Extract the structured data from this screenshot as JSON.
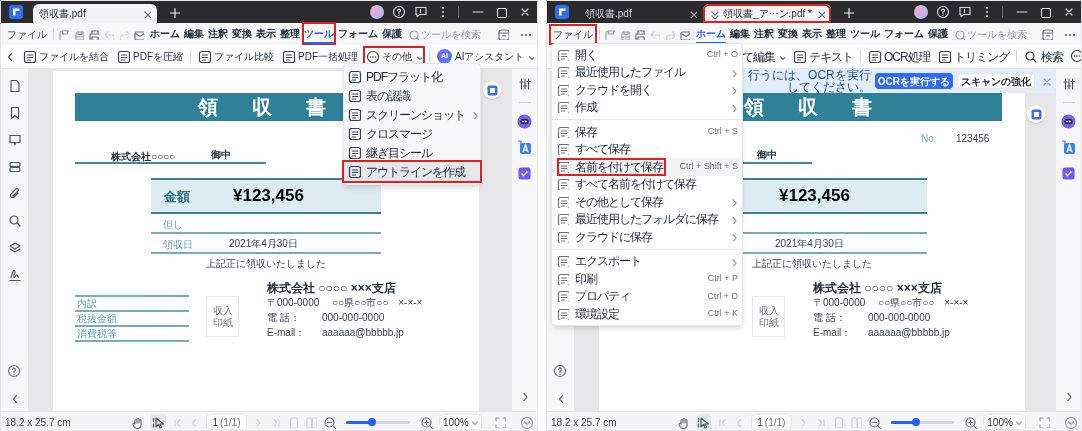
{
  "panes": [
    {
      "title_tabs": [
        {
          "label": "領収書.pdf",
          "selected": true,
          "highlighted": false,
          "kind": "plain"
        }
      ],
      "menubar": {
        "file": {
          "label": "ファイル",
          "highlighted": false
        },
        "search_placeholder": "ツールを検索",
        "tabs": [
          {
            "label": "ホーム",
            "selected": false,
            "highlighted": false
          },
          {
            "label": "編集",
            "selected": false,
            "highlighted": false
          },
          {
            "label": "注釈",
            "selected": false,
            "highlighted": false
          },
          {
            "label": "変換",
            "selected": false,
            "highlighted": false
          },
          {
            "label": "表示",
            "selected": false,
            "highlighted": false
          },
          {
            "label": "整理",
            "selected": false,
            "highlighted": false
          },
          {
            "label": "ツール",
            "selected": true,
            "highlighted": true
          },
          {
            "label": "フォーム",
            "selected": false,
            "highlighted": false
          },
          {
            "label": "保護",
            "selected": false,
            "highlighted": false
          }
        ]
      },
      "toolbar": [
        {
          "kind": "scroll"
        },
        {
          "kind": "button",
          "label": "ファイルを結合",
          "highlighted": false
        },
        {
          "kind": "button",
          "label": "PDFを圧縮",
          "highlighted": false
        },
        {
          "kind": "separator"
        },
        {
          "kind": "button",
          "label": "ファイル比較",
          "highlighted": false
        },
        {
          "kind": "button",
          "label": "PDF一括処理",
          "highlighted": false
        },
        {
          "kind": "dropdown",
          "label": "その他",
          "highlighted": true
        },
        {
          "kind": "separator"
        },
        {
          "kind": "ai",
          "badge": "AI",
          "label": "AIアシスタント",
          "highlighted": false
        }
      ],
      "tools_menu": {
        "items": [
          {
            "label": "PDFフラット化",
            "submenu": false,
            "highlighted": false
          },
          {
            "label": "表の認識",
            "submenu": false,
            "highlighted": false
          },
          {
            "label": "スクリーンショット",
            "submenu": true,
            "highlighted": false
          },
          {
            "label": "クロスマージ",
            "submenu": false,
            "highlighted": false
          },
          {
            "label": "継ぎ目シール",
            "submenu": false,
            "highlighted": false
          },
          {
            "label": "アウトラインを作成",
            "submenu": false,
            "highlighted": true
          }
        ]
      },
      "document": {
        "title": "領　収　書",
        "addressee": "株式会社○○○○",
        "honorific": "御中",
        "amount_label": "金額",
        "amount": "¥123,456",
        "proviso_label": "但し",
        "date_label": "領収日",
        "date": "2021年4月30日",
        "statement": "上記正に領収いたしました",
        "breakdown": [
          "内訳",
          "税抜金額",
          "消費税等"
        ],
        "stamp": "収入印紙",
        "company": "株式会社 ○○○○ ×××支店",
        "address": "〒000-0000　 ○○県○○市○○　×-×-×",
        "contacts": [
          {
            "label": "電 話：",
            "value": "000-000-0000"
          },
          {
            "label": "E-mail：",
            "value": "aaaaaa@bbbbb.jp"
          }
        ]
      },
      "status": {
        "size": "18.2 x 25.7 cm",
        "page": "1",
        "page_total": "(1/1)",
        "zoom_slider": {
          "level": 0.4
        },
        "zoom": "100%"
      }
    },
    {
      "title_tabs": [
        {
          "label": "領収書.pdf",
          "selected": false,
          "highlighted": false,
          "kind": "plain"
        },
        {
          "label": "領収書_ア···ン.pdf *",
          "selected": true,
          "highlighted": true,
          "kind": "collapsed"
        }
      ],
      "menubar": {
        "file": {
          "label": "ファイル",
          "highlighted": true
        },
        "search_placeholder": "ツールを検索",
        "tabs": [
          {
            "label": "ホーム",
            "selected": true,
            "highlighted": false
          },
          {
            "label": "編集",
            "selected": false,
            "highlighted": false
          },
          {
            "label": "注釈",
            "selected": false,
            "highlighted": false
          },
          {
            "label": "変換",
            "selected": false,
            "highlighted": false
          },
          {
            "label": "表示",
            "selected": false,
            "highlighted": false
          },
          {
            "label": "整理",
            "selected": false,
            "highlighted": false
          },
          {
            "label": "ツール",
            "selected": false,
            "highlighted": false
          },
          {
            "label": "フォーム",
            "selected": false,
            "highlighted": false
          },
          {
            "label": "保護",
            "selected": false,
            "highlighted": false
          }
        ]
      },
      "toolbar": [
        {
          "kind": "text_dropdown",
          "label": "て編集",
          "highlighted": false
        },
        {
          "kind": "button",
          "label": "テキスト",
          "highlighted": false
        },
        {
          "kind": "separator"
        },
        {
          "kind": "button",
          "label": "OCR処理",
          "highlighted": false
        },
        {
          "kind": "button",
          "label": "トリミング",
          "highlighted": false
        },
        {
          "kind": "separator"
        },
        {
          "kind": "search",
          "label": "検索",
          "highlighted": false
        },
        {
          "kind": "partial"
        }
      ],
      "banner": {
        "message": "行うには、OCRを実行してください。",
        "primary": "OCRを実行する",
        "secondary": "スキャンの強化"
      },
      "file_menu": {
        "items": [
          {
            "kind": "item",
            "label": "開く",
            "shortcut": "Ctrl + O",
            "submenu": false,
            "highlighted": false
          },
          {
            "kind": "item",
            "label": "最近使用したファイル",
            "submenu": true,
            "highlighted": false
          },
          {
            "kind": "item",
            "label": "クラウドを開く",
            "submenu": true,
            "highlighted": false
          },
          {
            "kind": "item",
            "label": "作成",
            "submenu": true,
            "highlighted": false
          },
          {
            "kind": "divider"
          },
          {
            "kind": "item",
            "label": "保存",
            "shortcut": "Ctrl + S",
            "submenu": false,
            "highlighted": false
          },
          {
            "kind": "item",
            "label": "すべて保存",
            "submenu": false,
            "highlighted": false
          },
          {
            "kind": "item",
            "label": "名前を付けて保存",
            "shortcut": "Ctrl + Shift + S",
            "submenu": false,
            "highlighted": true
          },
          {
            "kind": "item",
            "label": "すべて名前を付けて保存",
            "submenu": false,
            "highlighted": false
          },
          {
            "kind": "item",
            "label": "その他として保存",
            "submenu": true,
            "highlighted": false
          },
          {
            "kind": "item",
            "label": "最近使用したフォルダに保存",
            "submenu": true,
            "highlighted": false
          },
          {
            "kind": "item",
            "label": "クラウドに保存",
            "submenu": true,
            "highlighted": false
          },
          {
            "kind": "divider"
          },
          {
            "kind": "item",
            "label": "エクスポート",
            "submenu": true,
            "highlighted": false
          },
          {
            "kind": "item",
            "label": "印刷",
            "shortcut": "Ctrl + P",
            "submenu": false,
            "highlighted": false
          },
          {
            "kind": "item",
            "label": "プロパティ",
            "shortcut": "Ctrl + D",
            "submenu": false,
            "highlighted": false
          },
          {
            "kind": "item",
            "label": "環境設定",
            "shortcut": "Ctrl + K",
            "submenu": false,
            "highlighted": false
          }
        ]
      },
      "document": {
        "title": "領　収　書",
        "no_label": "No.",
        "no_value": "123456",
        "honorific": "御中",
        "amount": "¥123,456",
        "date": "2021年4月30日",
        "statement": "上記正に領収いたしました",
        "stamp": "収入印紙",
        "company": "株式会社 ○○○○ ×××支店",
        "address": "〒000-0000　 ○○県○○市○○　×-×-×",
        "contacts": [
          {
            "label": "電 話：",
            "value": "000-000-0000"
          },
          {
            "label": "E-mail：",
            "value": "aaaaaa@bbbbb.jp"
          }
        ]
      },
      "status": {
        "size": "18.2 x 25.7 cm",
        "page": "1",
        "page_total": "(1/1)",
        "zoom_slider": {
          "level": 0.4
        },
        "zoom": "100%"
      }
    }
  ]
}
